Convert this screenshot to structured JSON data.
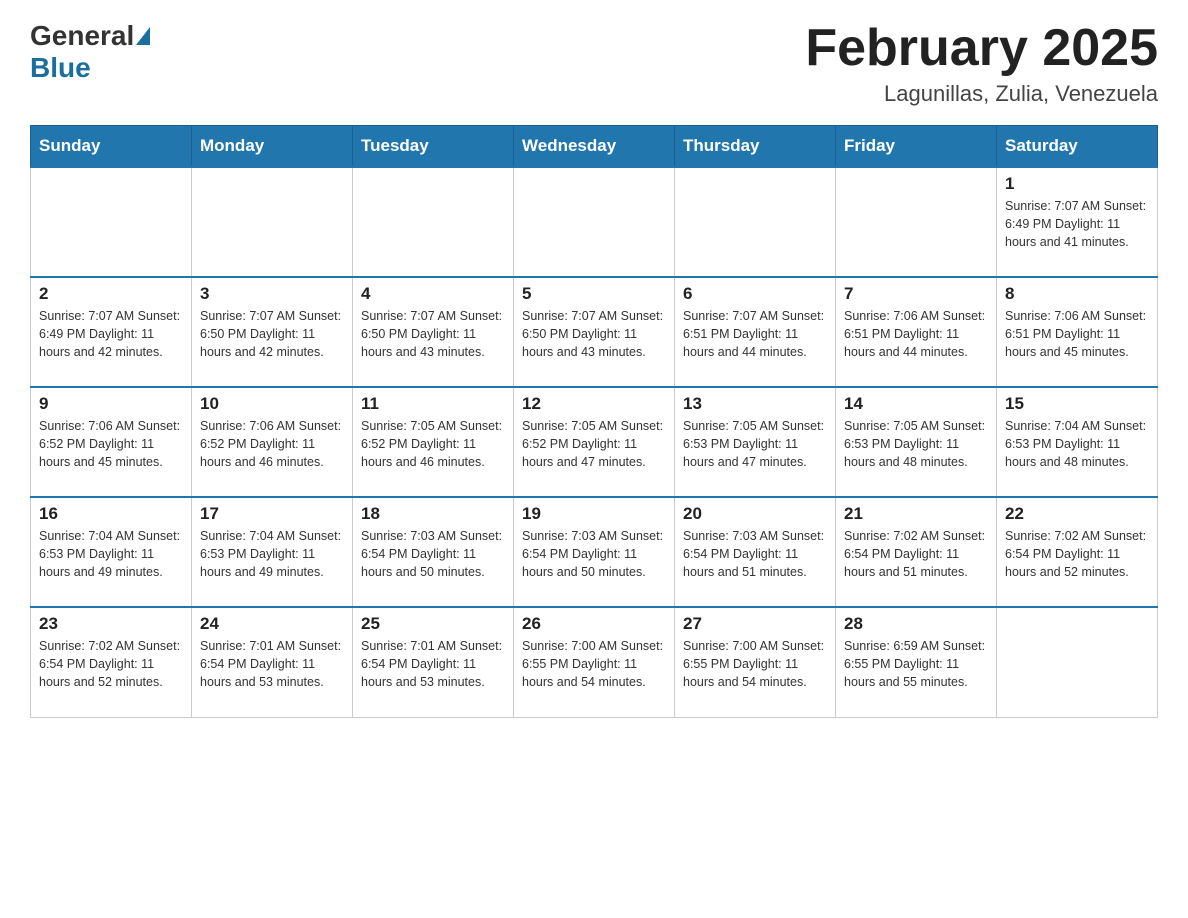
{
  "header": {
    "logo_general": "General",
    "logo_blue": "Blue",
    "title": "February 2025",
    "location": "Lagunillas, Zulia, Venezuela"
  },
  "weekdays": [
    "Sunday",
    "Monday",
    "Tuesday",
    "Wednesday",
    "Thursday",
    "Friday",
    "Saturday"
  ],
  "weeks": [
    [
      {
        "day": "",
        "info": ""
      },
      {
        "day": "",
        "info": ""
      },
      {
        "day": "",
        "info": ""
      },
      {
        "day": "",
        "info": ""
      },
      {
        "day": "",
        "info": ""
      },
      {
        "day": "",
        "info": ""
      },
      {
        "day": "1",
        "info": "Sunrise: 7:07 AM\nSunset: 6:49 PM\nDaylight: 11 hours\nand 41 minutes."
      }
    ],
    [
      {
        "day": "2",
        "info": "Sunrise: 7:07 AM\nSunset: 6:49 PM\nDaylight: 11 hours\nand 42 minutes."
      },
      {
        "day": "3",
        "info": "Sunrise: 7:07 AM\nSunset: 6:50 PM\nDaylight: 11 hours\nand 42 minutes."
      },
      {
        "day": "4",
        "info": "Sunrise: 7:07 AM\nSunset: 6:50 PM\nDaylight: 11 hours\nand 43 minutes."
      },
      {
        "day": "5",
        "info": "Sunrise: 7:07 AM\nSunset: 6:50 PM\nDaylight: 11 hours\nand 43 minutes."
      },
      {
        "day": "6",
        "info": "Sunrise: 7:07 AM\nSunset: 6:51 PM\nDaylight: 11 hours\nand 44 minutes."
      },
      {
        "day": "7",
        "info": "Sunrise: 7:06 AM\nSunset: 6:51 PM\nDaylight: 11 hours\nand 44 minutes."
      },
      {
        "day": "8",
        "info": "Sunrise: 7:06 AM\nSunset: 6:51 PM\nDaylight: 11 hours\nand 45 minutes."
      }
    ],
    [
      {
        "day": "9",
        "info": "Sunrise: 7:06 AM\nSunset: 6:52 PM\nDaylight: 11 hours\nand 45 minutes."
      },
      {
        "day": "10",
        "info": "Sunrise: 7:06 AM\nSunset: 6:52 PM\nDaylight: 11 hours\nand 46 minutes."
      },
      {
        "day": "11",
        "info": "Sunrise: 7:05 AM\nSunset: 6:52 PM\nDaylight: 11 hours\nand 46 minutes."
      },
      {
        "day": "12",
        "info": "Sunrise: 7:05 AM\nSunset: 6:52 PM\nDaylight: 11 hours\nand 47 minutes."
      },
      {
        "day": "13",
        "info": "Sunrise: 7:05 AM\nSunset: 6:53 PM\nDaylight: 11 hours\nand 47 minutes."
      },
      {
        "day": "14",
        "info": "Sunrise: 7:05 AM\nSunset: 6:53 PM\nDaylight: 11 hours\nand 48 minutes."
      },
      {
        "day": "15",
        "info": "Sunrise: 7:04 AM\nSunset: 6:53 PM\nDaylight: 11 hours\nand 48 minutes."
      }
    ],
    [
      {
        "day": "16",
        "info": "Sunrise: 7:04 AM\nSunset: 6:53 PM\nDaylight: 11 hours\nand 49 minutes."
      },
      {
        "day": "17",
        "info": "Sunrise: 7:04 AM\nSunset: 6:53 PM\nDaylight: 11 hours\nand 49 minutes."
      },
      {
        "day": "18",
        "info": "Sunrise: 7:03 AM\nSunset: 6:54 PM\nDaylight: 11 hours\nand 50 minutes."
      },
      {
        "day": "19",
        "info": "Sunrise: 7:03 AM\nSunset: 6:54 PM\nDaylight: 11 hours\nand 50 minutes."
      },
      {
        "day": "20",
        "info": "Sunrise: 7:03 AM\nSunset: 6:54 PM\nDaylight: 11 hours\nand 51 minutes."
      },
      {
        "day": "21",
        "info": "Sunrise: 7:02 AM\nSunset: 6:54 PM\nDaylight: 11 hours\nand 51 minutes."
      },
      {
        "day": "22",
        "info": "Sunrise: 7:02 AM\nSunset: 6:54 PM\nDaylight: 11 hours\nand 52 minutes."
      }
    ],
    [
      {
        "day": "23",
        "info": "Sunrise: 7:02 AM\nSunset: 6:54 PM\nDaylight: 11 hours\nand 52 minutes."
      },
      {
        "day": "24",
        "info": "Sunrise: 7:01 AM\nSunset: 6:54 PM\nDaylight: 11 hours\nand 53 minutes."
      },
      {
        "day": "25",
        "info": "Sunrise: 7:01 AM\nSunset: 6:54 PM\nDaylight: 11 hours\nand 53 minutes."
      },
      {
        "day": "26",
        "info": "Sunrise: 7:00 AM\nSunset: 6:55 PM\nDaylight: 11 hours\nand 54 minutes."
      },
      {
        "day": "27",
        "info": "Sunrise: 7:00 AM\nSunset: 6:55 PM\nDaylight: 11 hours\nand 54 minutes."
      },
      {
        "day": "28",
        "info": "Sunrise: 6:59 AM\nSunset: 6:55 PM\nDaylight: 11 hours\nand 55 minutes."
      },
      {
        "day": "",
        "info": ""
      }
    ]
  ]
}
